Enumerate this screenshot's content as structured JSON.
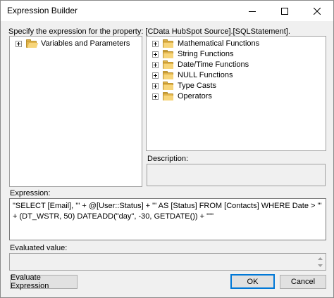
{
  "window": {
    "title": "Expression Builder"
  },
  "prompt": "Specify the expression for the property: [CData HubSpot Source].[SQLStatement].",
  "left_tree": {
    "items": [
      {
        "label": "Variables and Parameters"
      }
    ]
  },
  "right_tree": {
    "items": [
      {
        "label": "Mathematical Functions"
      },
      {
        "label": "String Functions"
      },
      {
        "label": "Date/Time Functions"
      },
      {
        "label": "NULL Functions"
      },
      {
        "label": "Type Casts"
      },
      {
        "label": "Operators"
      }
    ]
  },
  "description": {
    "label": "Description:"
  },
  "expression": {
    "label": "Expression:",
    "value": "\"SELECT [Email], '\" + @[User::Status] + \"' AS [Status] FROM [Contacts] WHERE Date > '\" + (DT_WSTR, 50) DATEADD(\"day\", -30, GETDATE()) + \"'\""
  },
  "evaluated": {
    "label": "Evaluated value:"
  },
  "buttons": {
    "evaluate": "Evaluate Expression",
    "ok": "OK",
    "cancel": "Cancel"
  },
  "icons": {
    "minimize": "minimize-icon",
    "maximize": "maximize-icon",
    "close": "close-icon",
    "folder": "folder-icon",
    "expander": "plus-expander-icon"
  }
}
